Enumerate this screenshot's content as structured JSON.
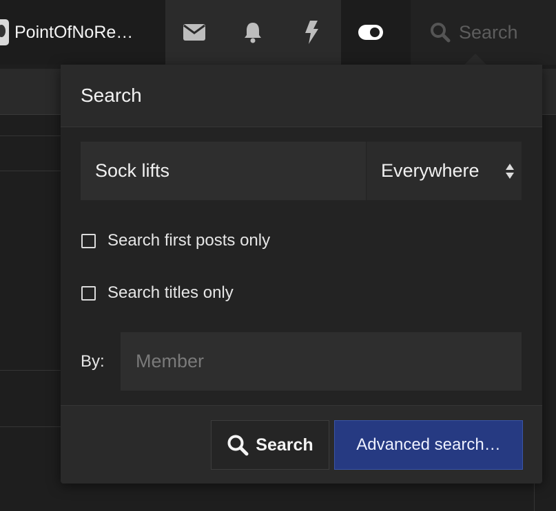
{
  "nav": {
    "username": "PointOfNoRe…",
    "icons": [
      "envelope-icon",
      "bell-icon",
      "bolt-icon",
      "toggle-icon"
    ],
    "search_label": "Search"
  },
  "search_menu": {
    "title": "Search",
    "keywords_value": "Sock lifts",
    "scope_value": "Everywhere",
    "options": [
      {
        "label": "Search first posts only",
        "checked": false
      },
      {
        "label": "Search titles only",
        "checked": false
      }
    ],
    "by_label": "By:",
    "member_placeholder": "Member",
    "search_button": "Search",
    "advanced_button": "Advanced search…"
  },
  "colors": {
    "accent_button": "#263a82",
    "background": "#1e1e1e",
    "panel": "#232323"
  }
}
